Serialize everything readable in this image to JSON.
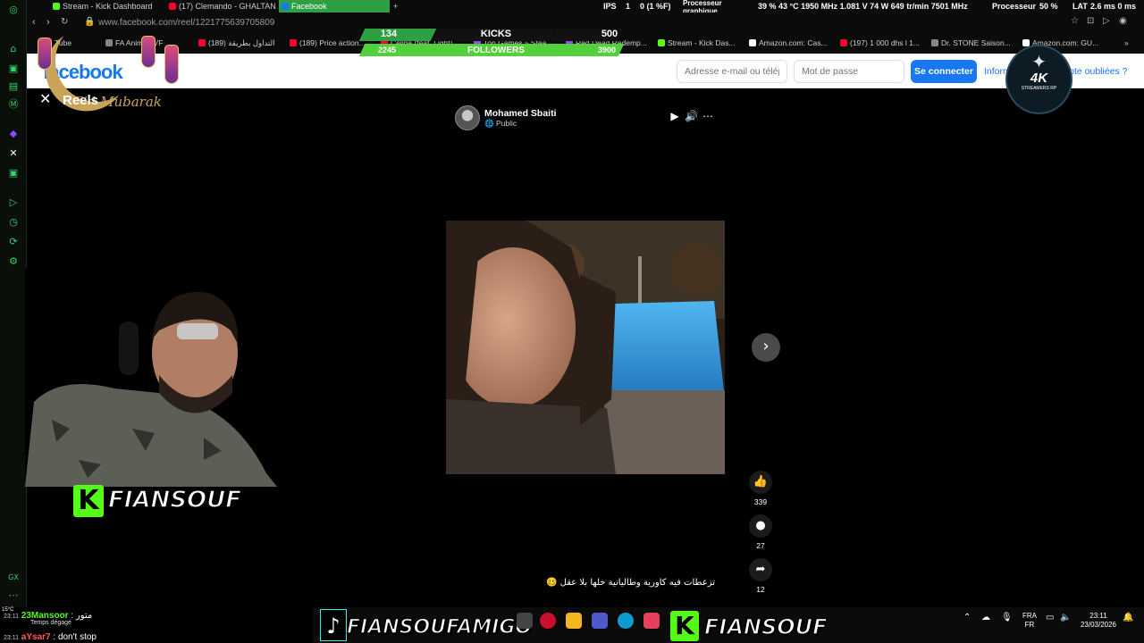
{
  "tabs": [
    {
      "label": "Stream - Kick Dashboard",
      "color": "#53fc18"
    },
    {
      "label": "(17) Clemando - GHALTAN",
      "color": "#ff0033"
    },
    {
      "label": "Facebook",
      "color": "#1877f2"
    }
  ],
  "perf": {
    "ips_label": "IPS",
    "ips_value": "1",
    "low_value": "0 (1 %F)",
    "gpu_label_1": "Processeur",
    "gpu_label_2": "graphique",
    "gpu_stats": "39 % 43 °C 1950 MHz 1.081 V 74 W 649 tr/min 7501 MHz",
    "cpu_label": "Processeur",
    "cpu_value": "50 %",
    "lat_label": "LAT",
    "lat_value": "2.6 ms 0 ms"
  },
  "address": {
    "url": "www.facebook.com/reel/1221775639705809"
  },
  "bookmarks": [
    {
      "label": "Tube",
      "color": "#ff0033"
    },
    {
      "label": "FA Animes VF",
      "color": "#888888"
    },
    {
      "label": "(189) التداول بطريقة",
      "color": "#ff0033"
    },
    {
      "label": "(189) Price action...",
      "color": "#ff0033"
    },
    {
      "label": "Celine (feat. Light)",
      "color": "#ff0033"
    },
    {
      "label": "Top Games » Stea...",
      "color": "#9146ff"
    },
    {
      "label": "Red Dead Redemp...",
      "color": "#9146ff"
    },
    {
      "label": "Stream - Kick Das...",
      "color": "#53fc18"
    },
    {
      "label": "Amazon.com: Cas...",
      "color": "#ffffff"
    },
    {
      "label": "(197) 1 000 dhs l 1...",
      "color": "#ff0033"
    },
    {
      "label": "Dr. STONE Saison...",
      "color": "#888888"
    },
    {
      "label": "Amazon.com: GU...",
      "color": "#ffffff"
    }
  ],
  "overlay": {
    "kicks_left": "134",
    "kicks_label": "KICKS",
    "kicks_right": "500",
    "followers_left": "2245",
    "followers_label": "FOLLOWERS",
    "followers_right": "3900"
  },
  "facebook": {
    "logo": "facebook",
    "email_placeholder": "Adresse e-mail ou télép",
    "password_placeholder": "Mot de passe",
    "login_label": "Se connecter",
    "forgot_label": "Informations de compte oubliées ?"
  },
  "decor": {
    "greeting": "Eid Mubarak"
  },
  "reel": {
    "title": "Reels",
    "author": "Mohamed Sbaiti",
    "privacy": "Public",
    "likes": "339",
    "comments": "27",
    "shares": "12",
    "caption": "تزعطات فيه كاورية وطاليانية خلها بلا عقل 🥴"
  },
  "stream_branding": {
    "webcam_name": "FIANSOUF",
    "taskbar_tag_1": "FIANSOUFAMIGO",
    "taskbar_tag_2": "FIANSOUF",
    "ak_logo_main": "4K",
    "ak_logo_sub": "STREAMERS RP"
  },
  "chat": [
    {
      "time": "23:11",
      "user": "23Mansoor",
      "text": "متور",
      "user_color": "#53fc18"
    },
    {
      "time": "23:11",
      "user": "aYsar7",
      "text": "don't stop",
      "user_color": "#ff5c5c"
    }
  ],
  "weather": {
    "temp": "15°C",
    "condition": "Temps dégagé"
  },
  "tray": {
    "lang_1": "FRA",
    "lang_2": "FR",
    "time": "23:11",
    "date": "23/03/2026"
  },
  "icons": [
    "whatsapp-icon",
    "twitch-icon",
    "x-icon",
    "kick-icon",
    "play-icon",
    "clock-icon",
    "gear-icon",
    "like-icon",
    "comment-icon",
    "share-icon",
    "close-icon",
    "volume-icon",
    "more-icon",
    "next-icon"
  ]
}
